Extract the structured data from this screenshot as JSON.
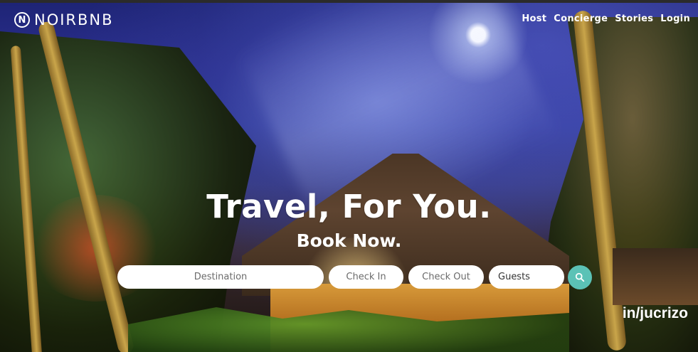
{
  "brand": {
    "name": "NOIRBNB",
    "logo_icon": "circle-n-logo-icon"
  },
  "nav": {
    "items": [
      {
        "label": "Host"
      },
      {
        "label": "Concierge"
      },
      {
        "label": "Stories"
      },
      {
        "label": "Login"
      }
    ]
  },
  "hero": {
    "title": "Travel, For You.",
    "subtitle": "Book Now."
  },
  "search": {
    "destination_placeholder": "Destination",
    "checkin_placeholder": "Check In",
    "checkout_placeholder": "Check Out",
    "guests_label": "Guests",
    "button_icon": "search-icon",
    "button_color": "#5bc2b6"
  },
  "watermark": {
    "text": "in/jucrizo"
  }
}
